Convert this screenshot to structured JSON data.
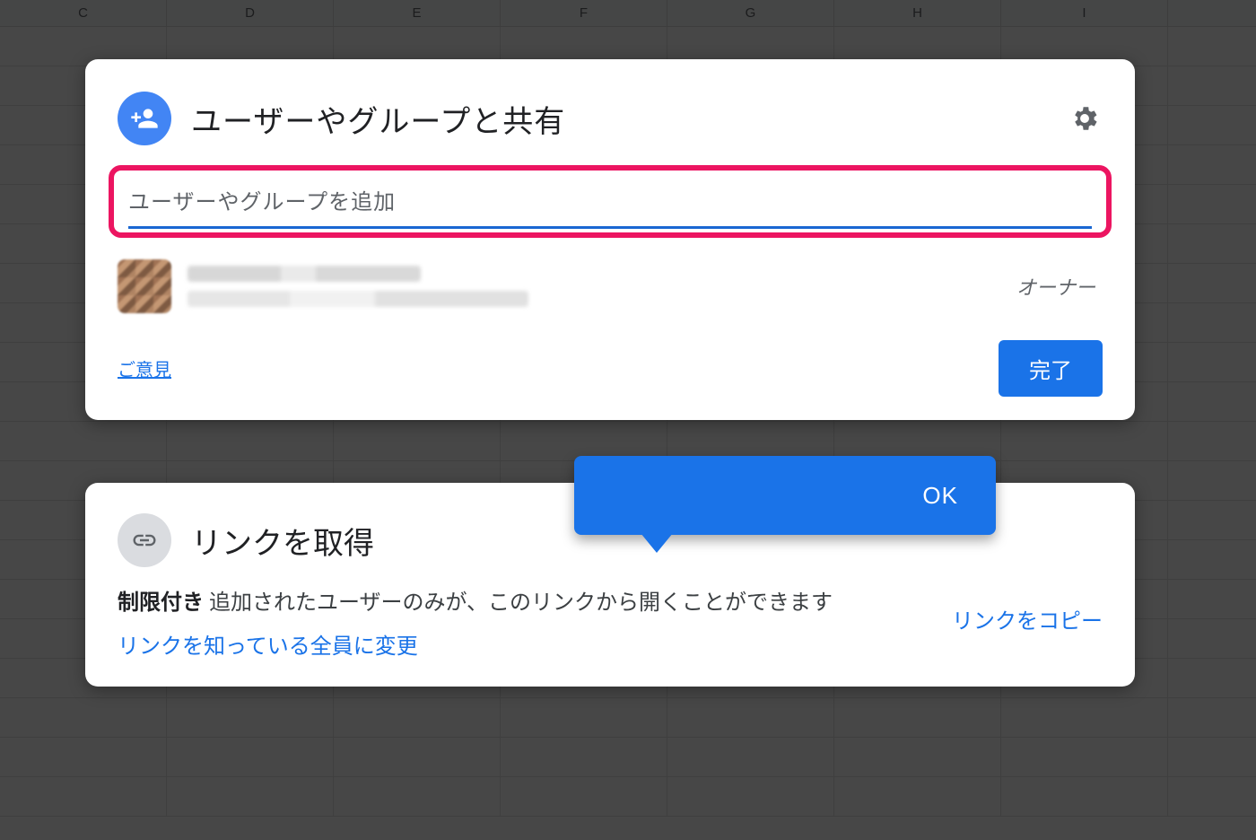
{
  "background": {
    "columns": [
      "C",
      "D",
      "E",
      "F",
      "G",
      "H",
      "I"
    ]
  },
  "share_card": {
    "title": "ユーザーやグループと共有",
    "input_placeholder": "ユーザーやグループを追加",
    "owner_role": "オーナー",
    "feedback_label": "ご意見",
    "done_label": "完了"
  },
  "callout": {
    "ok_label": "OK"
  },
  "link_card": {
    "title": "リンクを取得",
    "restricted_prefix": "制限付き",
    "restricted_text": "追加されたユーザーのみが、このリンクから開くことができます",
    "change_anyone": "リンクを知っている全員に変更",
    "copy_link": "リンクをコピー"
  }
}
